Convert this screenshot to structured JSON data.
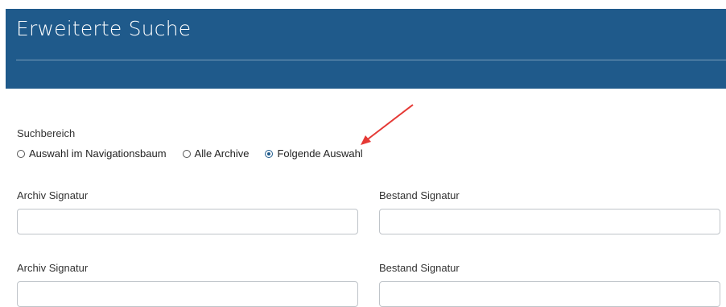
{
  "header": {
    "title": "Erweiterte Suche"
  },
  "scope": {
    "label": "Suchbereich",
    "options": [
      {
        "label": "Auswahl im Navigationsbaum",
        "checked": false
      },
      {
        "label": "Alle Archive",
        "checked": false
      },
      {
        "label": "Folgende Auswahl",
        "checked": true
      }
    ]
  },
  "rows": [
    {
      "archive_label": "Archiv Signatur",
      "archive_value": "",
      "holding_label": "Bestand Signatur",
      "holding_value": ""
    },
    {
      "archive_label": "Archiv Signatur",
      "archive_value": "",
      "holding_label": "Bestand Signatur",
      "holding_value": ""
    }
  ],
  "colors": {
    "header_bg": "#1f5a8b",
    "arrow": "#e53935"
  }
}
